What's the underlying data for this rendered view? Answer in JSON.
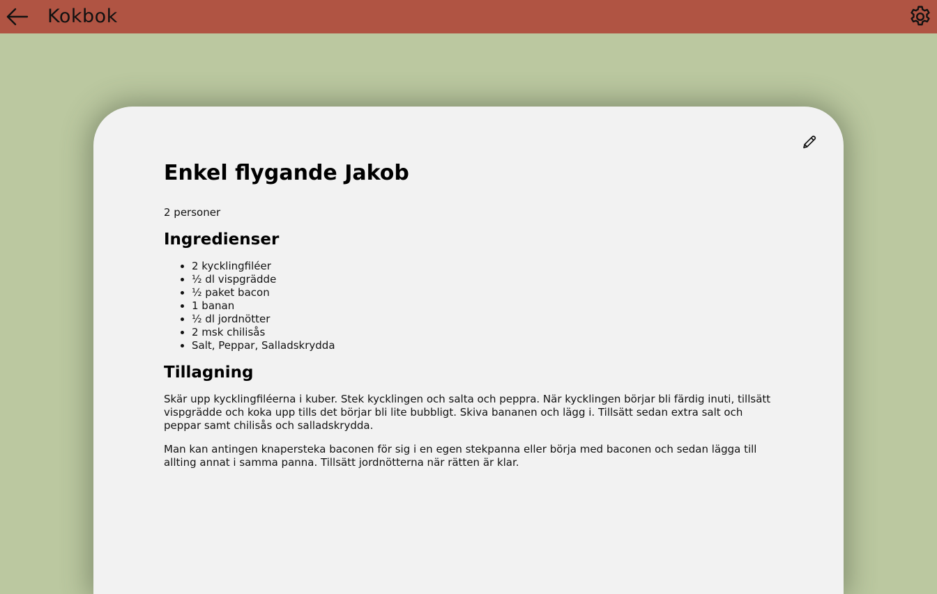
{
  "app": {
    "title": "Kokbok",
    "icons": {
      "back": "arrow-left-icon",
      "settings": "gear-icon",
      "edit": "pencil-icon"
    },
    "colors": {
      "header": "#b05443",
      "background": "#bbc8a0",
      "card": "#f2f2f2"
    }
  },
  "recipe": {
    "title": "Enkel flygande Jakob",
    "servings": "2 personer",
    "ingredients_heading": "Ingredienser",
    "ingredients": [
      "2 kycklingfiléer",
      "½ dl vispgrädde",
      "½ paket bacon",
      "1 banan",
      "½ dl jordnötter",
      "2 msk chilisås",
      "Salt, Peppar, Salladskrydda"
    ],
    "instructions_heading": "Tillagning",
    "instructions": [
      "Skär upp kycklingfiléerna i kuber. Stek kycklingen och salta och peppra. När kycklingen börjar bli färdig inuti, tillsätt vispgrädde och koka upp tills det börjar bli lite bubbligt. Skiva bananen och lägg i. Tillsätt sedan extra salt och peppar samt chilisås och salladskrydda.",
      "Man kan antingen knapersteka baconen för sig i en egen stekpanna eller börja med baconen och sedan lägga till allting annat i samma panna. Tillsätt jordnötterna när rätten är klar."
    ]
  }
}
